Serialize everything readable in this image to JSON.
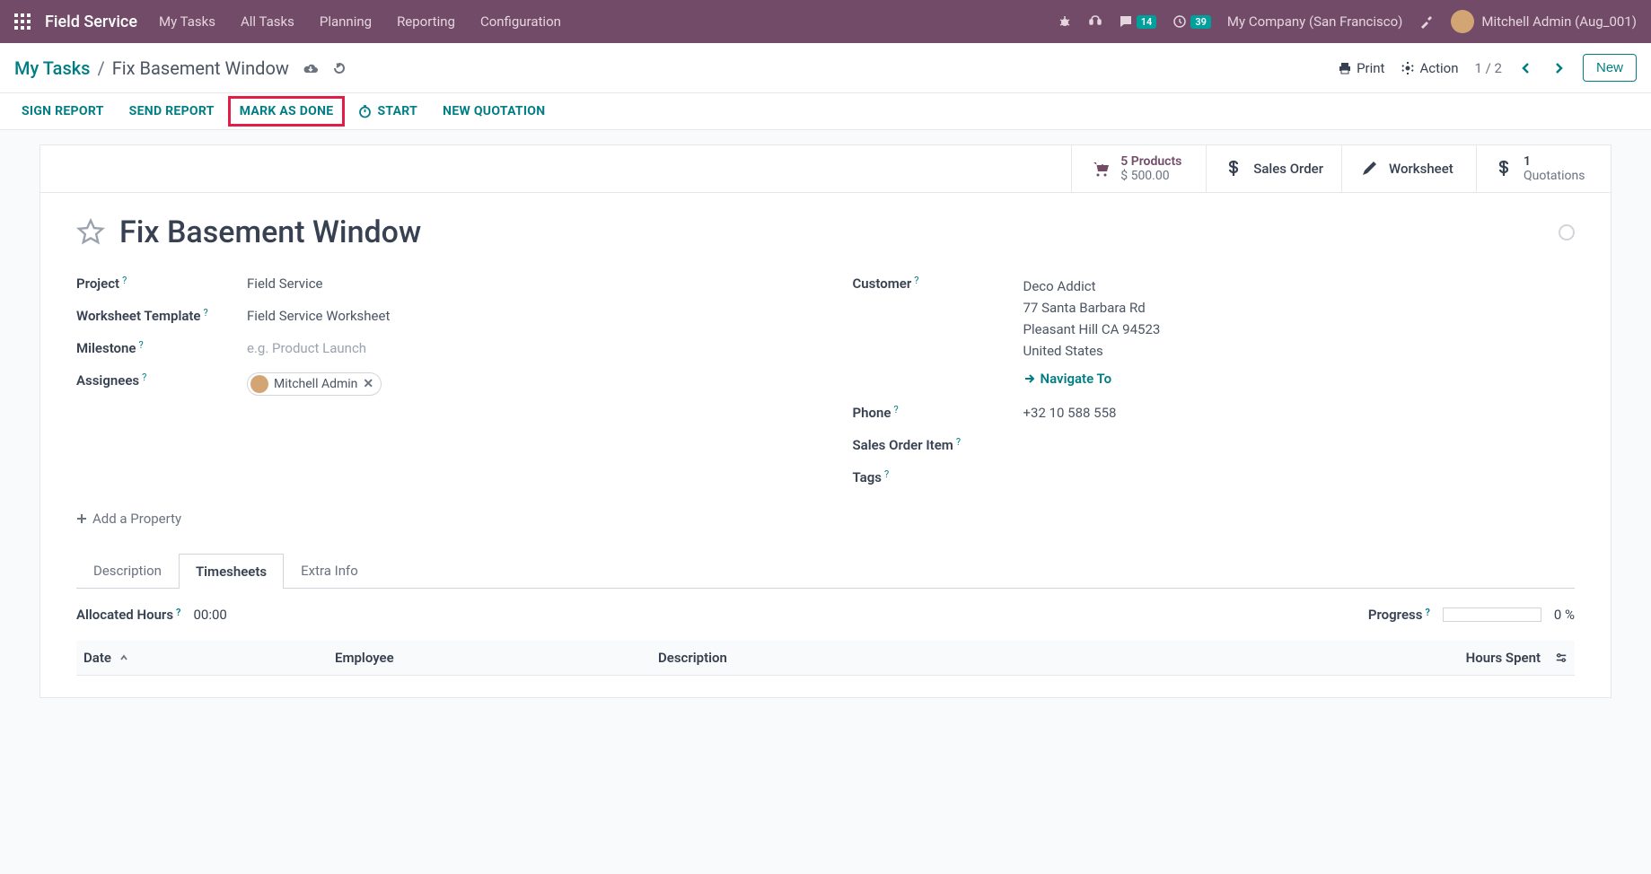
{
  "navbar": {
    "brand": "Field Service",
    "menu": [
      "My Tasks",
      "All Tasks",
      "Planning",
      "Reporting",
      "Configuration"
    ],
    "messages_badge": "14",
    "activities_badge": "39",
    "company": "My Company (San Francisco)",
    "user": "Mitchell Admin (Aug_001)"
  },
  "breadcrumb": {
    "parent": "My Tasks",
    "current": "Fix Basement Window",
    "print": "Print",
    "action": "Action",
    "pager": "1 / 2",
    "new": "New"
  },
  "action_buttons": {
    "sign_report": "SIGN REPORT",
    "send_report": "SEND REPORT",
    "mark_as_done": "MARK AS DONE",
    "start": "START",
    "new_quotation": "NEW QUOTATION"
  },
  "stats": {
    "products_count": "5 Products",
    "products_value": "$ 500.00",
    "sales_order": "Sales Order",
    "worksheet": "Worksheet",
    "quotations_count": "1",
    "quotations_label": "Quotations"
  },
  "task": {
    "title": "Fix Basement Window",
    "fields_left": {
      "project_label": "Project",
      "project_value": "Field Service",
      "worksheet_label": "Worksheet Template",
      "worksheet_value": "Field Service Worksheet",
      "milestone_label": "Milestone",
      "milestone_placeholder": "e.g. Product Launch",
      "assignees_label": "Assignees",
      "assignee_name": "Mitchell Admin"
    },
    "fields_right": {
      "customer_label": "Customer",
      "customer_name": "Deco Addict",
      "customer_street": "77 Santa Barbara Rd",
      "customer_city": "Pleasant Hill CA 94523",
      "customer_country": "United States",
      "navigate": "Navigate To",
      "phone_label": "Phone",
      "phone_value": "+32 10 588 558",
      "soi_label": "Sales Order Item",
      "tags_label": "Tags"
    },
    "add_property": "Add a Property"
  },
  "tabs": {
    "description": "Description",
    "timesheets": "Timesheets",
    "extra": "Extra Info"
  },
  "timesheet": {
    "allocated_label": "Allocated Hours",
    "allocated_value": "00:00",
    "progress_label": "Progress",
    "progress_value": "0 %",
    "col_date": "Date",
    "col_employee": "Employee",
    "col_description": "Description",
    "col_hours": "Hours Spent"
  }
}
